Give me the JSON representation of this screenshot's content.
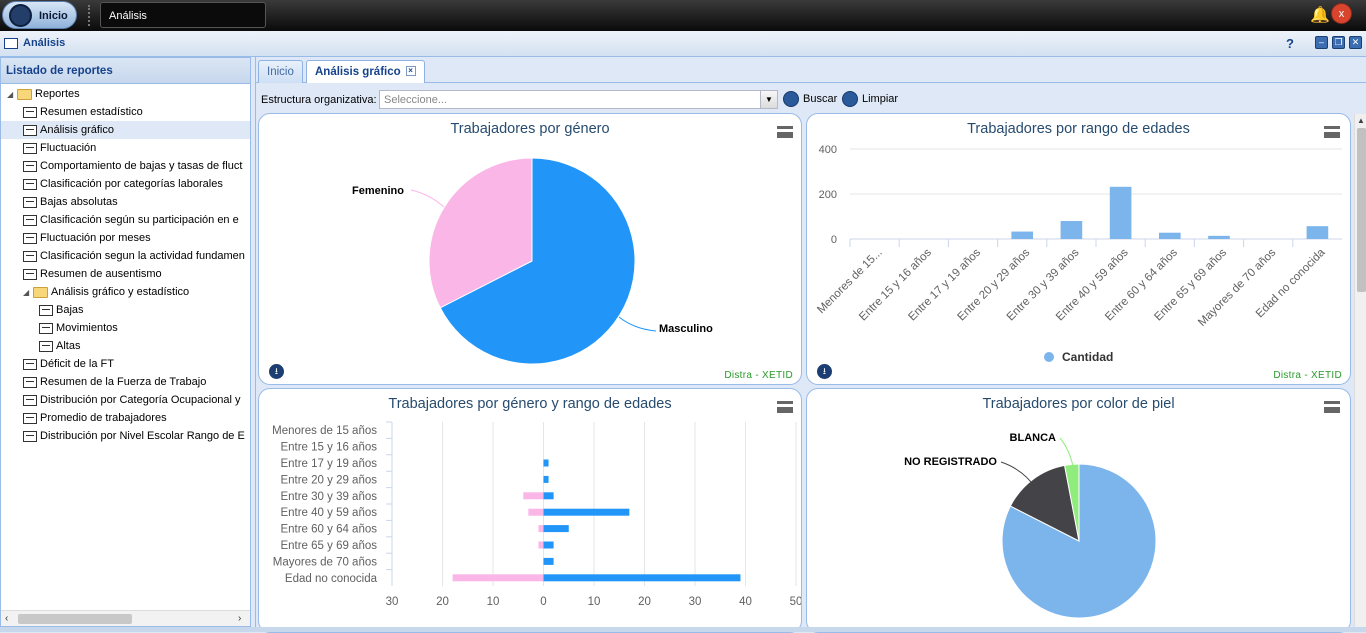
{
  "taskbar": {
    "start_label": "Inicio",
    "window_button": "Análisis",
    "close_symbol": "x"
  },
  "window": {
    "title": "Análisis",
    "help": "?"
  },
  "sidebar": {
    "title": "Listado de reportes",
    "items": [
      {
        "label": "Reportes",
        "kind": "folder",
        "level": 0,
        "expanded": true
      },
      {
        "label": "Resumen estadístico",
        "kind": "report",
        "level": 1
      },
      {
        "label": "Análisis gráfico",
        "kind": "report",
        "level": 1,
        "selected": true
      },
      {
        "label": "Fluctuación",
        "kind": "report",
        "level": 1
      },
      {
        "label": "Comportamiento de bajas y tasas de fluct",
        "kind": "report",
        "level": 1
      },
      {
        "label": "Clasificación por categorías laborales",
        "kind": "report",
        "level": 1
      },
      {
        "label": "Bajas absolutas",
        "kind": "report",
        "level": 1
      },
      {
        "label": "Clasificación según su participación en e",
        "kind": "report",
        "level": 1
      },
      {
        "label": "Fluctuación por meses",
        "kind": "report",
        "level": 1
      },
      {
        "label": "Clasificación segun la actividad fundamen",
        "kind": "report",
        "level": 1
      },
      {
        "label": "Resumen de ausentismo",
        "kind": "report",
        "level": 1
      },
      {
        "label": "Análisis gráfico y estadístico",
        "kind": "folder",
        "level": 1,
        "expanded": true
      },
      {
        "label": "Bajas",
        "kind": "report",
        "level": 2
      },
      {
        "label": "Movimientos",
        "kind": "report",
        "level": 2
      },
      {
        "label": "Altas",
        "kind": "report",
        "level": 2
      },
      {
        "label": "Déficit de la FT",
        "kind": "report",
        "level": 1
      },
      {
        "label": "Resumen de la Fuerza de Trabajo",
        "kind": "report",
        "level": 1
      },
      {
        "label": "Distribución por Categoría Ocupacional y",
        "kind": "report",
        "level": 1
      },
      {
        "label": "Promedio de trabajadores",
        "kind": "report",
        "level": 1
      },
      {
        "label": "Distribución por Nivel Escolar Rango de E",
        "kind": "report",
        "level": 1
      }
    ]
  },
  "tabs": [
    {
      "label": "Inicio"
    },
    {
      "label": "Análisis gráfico",
      "active": true,
      "close": "×"
    }
  ],
  "toolbar": {
    "structure_label": "Estructura organizativa:",
    "structure_placeholder": "Seleccione...",
    "search_label": "Buscar",
    "clear_label": "Limpiar"
  },
  "credits": "Distra - XETID",
  "colors": {
    "blue": "#2196f8",
    "pink": "#fbb6e8",
    "lightblue": "#7cb5ec",
    "dark": "#434348",
    "green": "#90ed7d"
  },
  "chart_data": [
    {
      "type": "pie",
      "title": "Trabajadores por género",
      "slices": [
        {
          "name": "Masculino",
          "value": 67.5,
          "color": "#2196f8"
        },
        {
          "name": "Femenino",
          "value": 32.5,
          "color": "#fbb6e8"
        }
      ]
    },
    {
      "type": "bar",
      "title": "Trabajadores por rango de edades",
      "categories": [
        "Menores de 15...",
        "Entre 15 y 16 años",
        "Entre 17 y 19 años",
        "Entre 20 y 29 años",
        "Entre 30 y 39 años",
        "Entre 40 y 59 años",
        "Entre 60 y 64 años",
        "Entre 65 y 69 años",
        "Mayores de 70 años",
        "Edad no conocida"
      ],
      "series": [
        {
          "name": "Cantidad",
          "values": [
            0,
            0,
            0,
            33,
            80,
            232,
            28,
            14,
            0,
            57
          ]
        }
      ],
      "ylim": [
        0,
        400
      ],
      "yticks": [
        0,
        200,
        400
      ],
      "legend": "bottom"
    },
    {
      "type": "bar",
      "orientation": "horizontal",
      "title": "Trabajadores por género y rango de edades",
      "categories": [
        "Menores de 15 años",
        "Entre 15 y 16 años",
        "Entre 17 y 19 años",
        "Entre 20 y 29 años",
        "Entre 30 y 39 años",
        "Entre 40 y 59 años",
        "Entre 60 y 64 años",
        "Entre 65 y 69 años",
        "Mayores de 70 años",
        "Edad no conocida"
      ],
      "series": [
        {
          "color": "#fbb6e8",
          "values": [
            0,
            0,
            0,
            0,
            -4,
            -3,
            -1,
            -1,
            0,
            -18
          ]
        },
        {
          "color": "#2196f8",
          "values": [
            0,
            0,
            1,
            1,
            2,
            17,
            5,
            2,
            2,
            39
          ]
        }
      ],
      "xlim": [
        -30,
        50
      ],
      "xticks": [
        "30",
        "20",
        "10",
        "0",
        "10",
        "20",
        "30",
        "40",
        "50"
      ]
    },
    {
      "type": "pie",
      "title": "Trabajadores por color de piel",
      "slices": [
        {
          "name": "",
          "value": 82.5,
          "color": "#7cb5ec"
        },
        {
          "name": "NO REGISTRADO",
          "value": 14.5,
          "color": "#434348"
        },
        {
          "name": "BLANCA",
          "value": 3,
          "color": "#90ed7d"
        }
      ]
    }
  ]
}
